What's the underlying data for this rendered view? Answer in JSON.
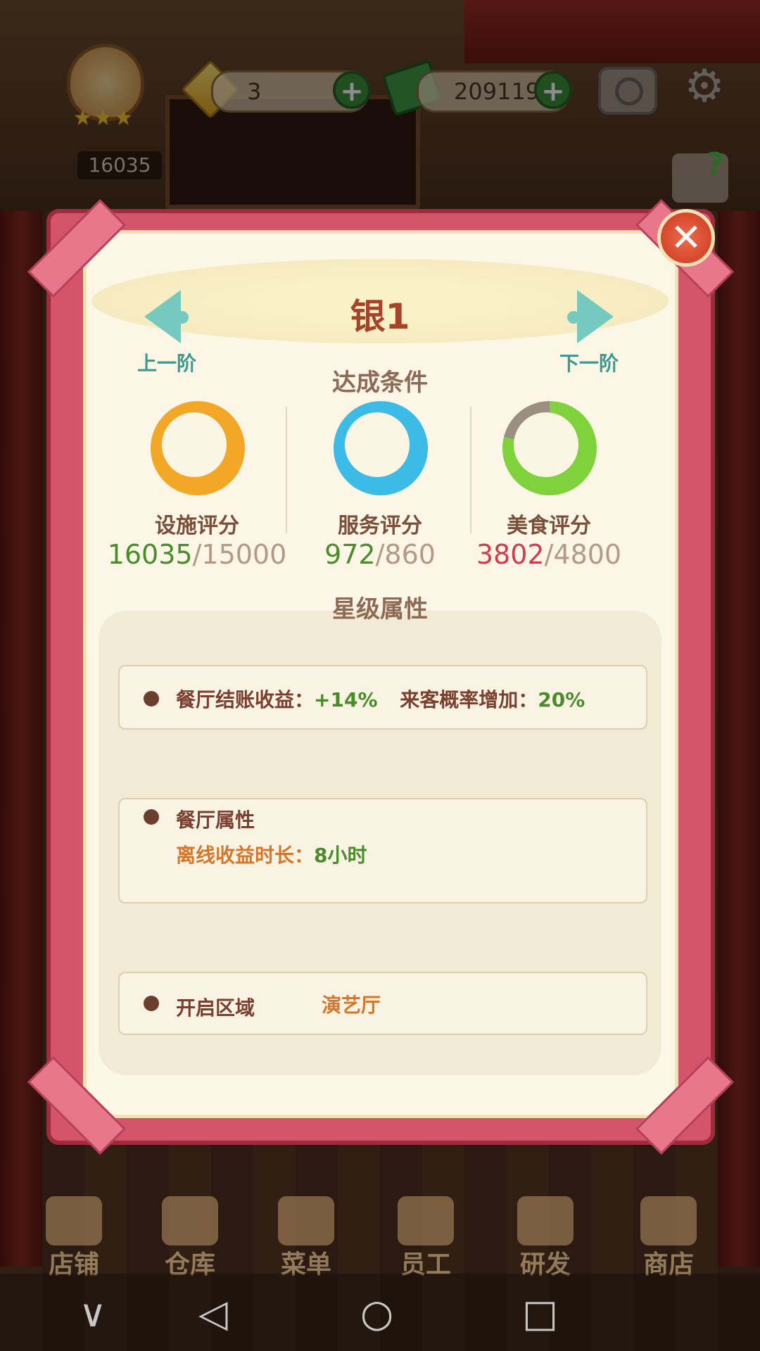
{
  "hud": {
    "facility_score": "16035",
    "gems": "3",
    "cash": "209119",
    "plus_label": "+",
    "rank_stars": "★★★"
  },
  "popup": {
    "tier_title": "银1",
    "prev_label": "上一阶",
    "next_label": "下一阶",
    "conditions_title": "达成条件",
    "close_label": "✕",
    "scores": [
      {
        "label": "设施评分",
        "current": "16035",
        "target": "/15000",
        "ring_color": "#f3a726",
        "current_color": "#4b8c2a",
        "icon": "cauldron-icon",
        "progress": 1.0
      },
      {
        "label": "服务评分",
        "current": "972",
        "target": "/860",
        "ring_color": "#3cbbe6",
        "current_color": "#4b8c2a",
        "icon": "serving-tray-icon",
        "progress": 1.0
      },
      {
        "label": "美食评分",
        "current": "3802",
        "target": "/4800",
        "ring_color": "#7fd23c",
        "current_color": "#d23a4e",
        "icon": "recipe-book-icon",
        "progress": 0.79
      }
    ],
    "star_attr_title": "星级属性",
    "attr1": {
      "label1": "餐厅结账收益：",
      "value1": "+14%",
      "label2": "来客概率增加：",
      "value2": "20%"
    },
    "attr2": {
      "title": "餐厅属性",
      "label": "离线收益时长：",
      "value": "8小时"
    },
    "attr3": {
      "label": "开启区域",
      "value": "演艺厅"
    }
  },
  "bottom_tabs": [
    "店铺",
    "仓库",
    "菜单",
    "员工",
    "研发",
    "商店"
  ],
  "system_nav": {
    "back": "◁",
    "home": "○",
    "recents": "□",
    "collapse": "∨"
  }
}
